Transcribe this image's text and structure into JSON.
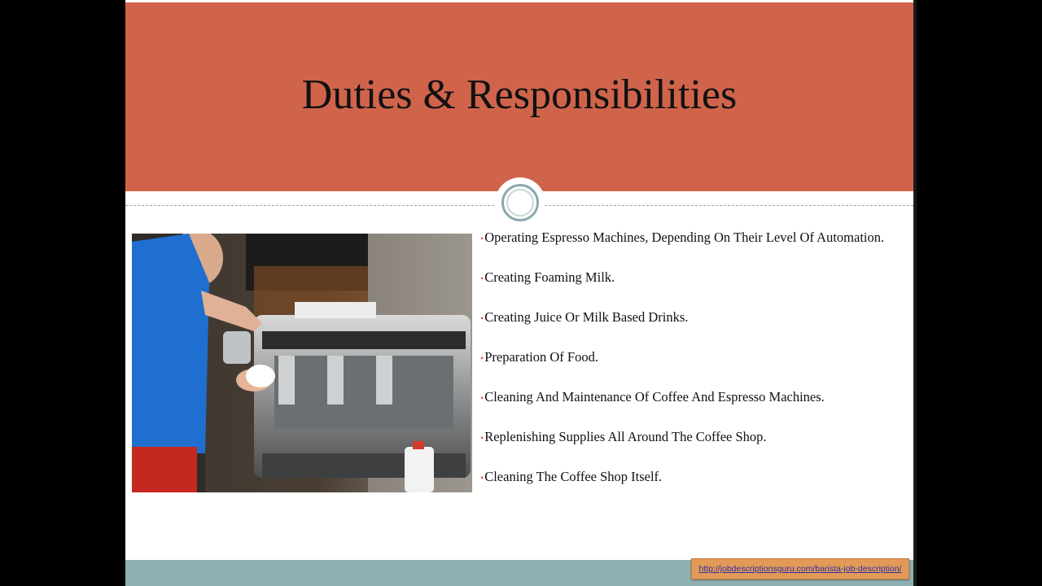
{
  "slide": {
    "title": "Duties & Responsibilities",
    "bullets": [
      "Operating Espresso Machines, Depending On Their Level Of Automation.",
      "Creating Foaming Milk.",
      "Creating Juice Or Milk Based Drinks.",
      "Preparation Of Food.",
      "Cleaning And Maintenance Of Coffee And Espresso Machines.",
      "Replenishing Supplies All Around The Coffee Shop.",
      "Cleaning The Coffee Shop Itself."
    ],
    "bullet_glyph": "•",
    "photo_icon": "barista-espresso-photo",
    "source_link": "http://jobdescriptionsguru.com/barista-job-description/"
  },
  "colors": {
    "title_band": "#d0644b",
    "footer_band": "#8fb0b1",
    "link_box": "#e39a57",
    "link_text": "#2d31a8"
  }
}
